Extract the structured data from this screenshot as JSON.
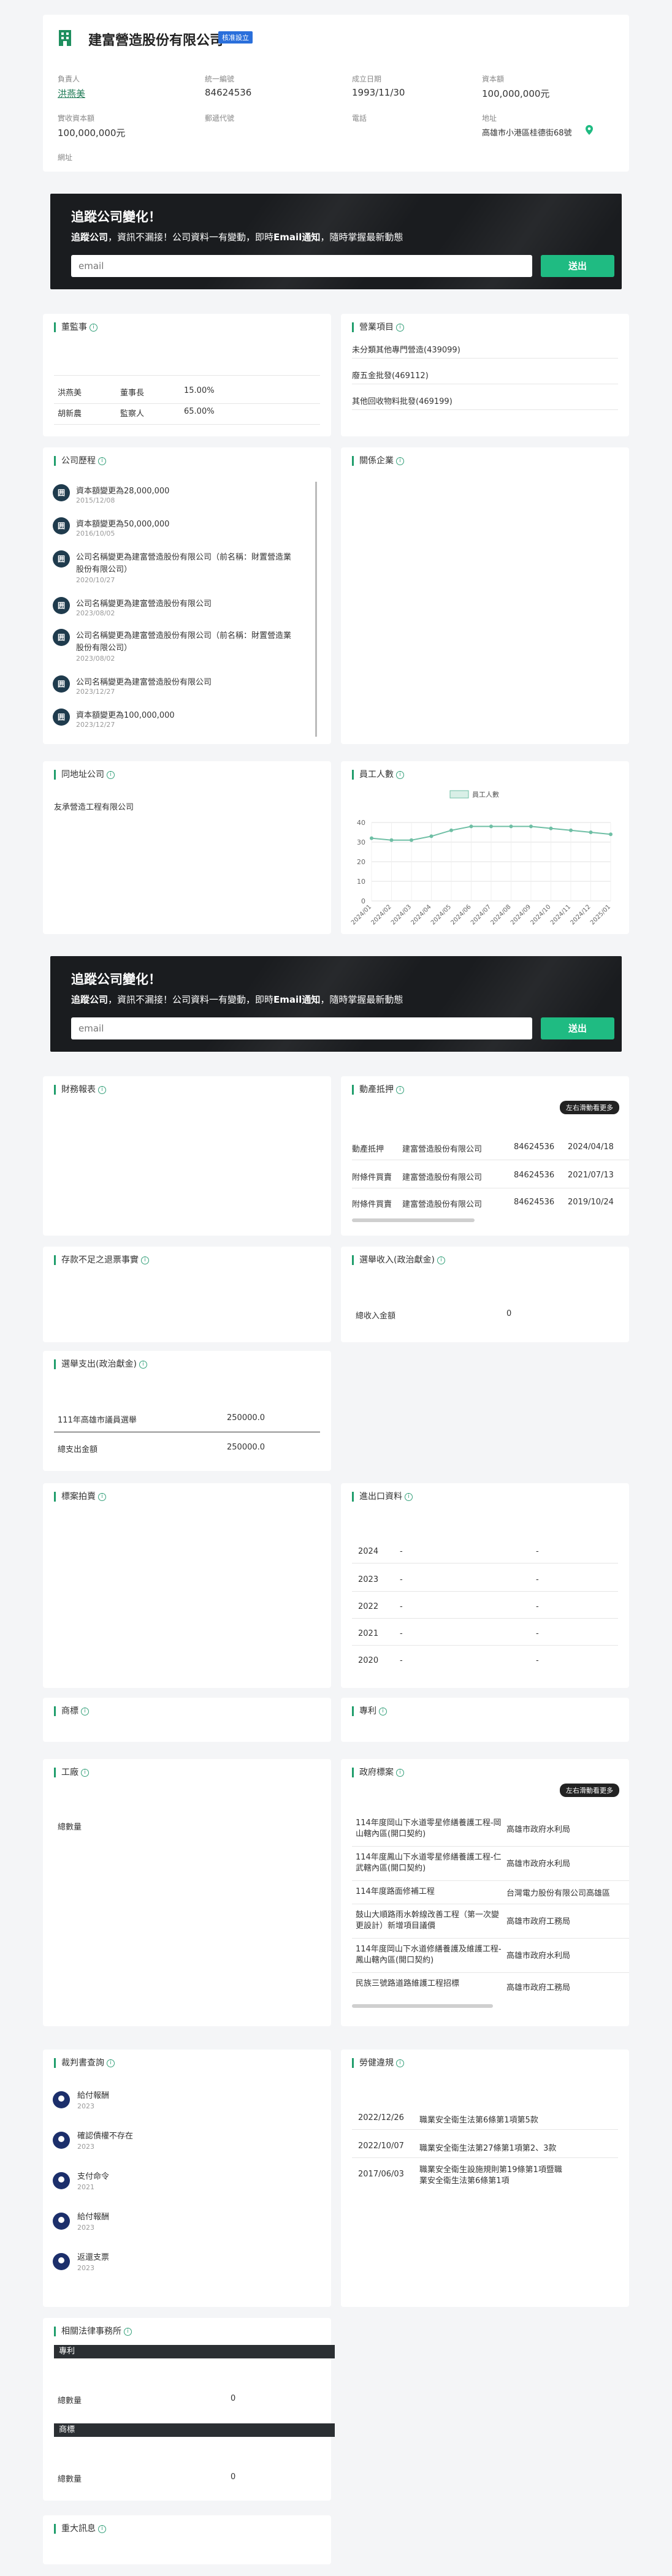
{
  "company": {
    "name": "建富營造股份有限公司",
    "status_badge": "核准設立",
    "fields": [
      {
        "label": "負責人",
        "value": "洪燕美"
      },
      {
        "label": "統一編號",
        "value": "84624536"
      },
      {
        "label": "成立日期",
        "value": "1993/11/30"
      },
      {
        "label": "資本額",
        "value": "100,000,000元"
      },
      {
        "label": "實收資本額",
        "value": "100,000,000元"
      },
      {
        "label": "郵遞代號",
        "value": ""
      },
      {
        "label": "電話",
        "value": ""
      },
      {
        "label": "地址",
        "value": "高雄市小港區桂德街68號"
      },
      {
        "label": "網址",
        "value": ""
      }
    ]
  },
  "banner": {
    "title": "追蹤公司變化！",
    "text_bold": "追蹤公司",
    "text_rest": "，資訊不漏接！公司資料一有變動，即時",
    "text_bold2": "Email通知",
    "text_end": "，隨時掌握最新動態",
    "placeholder": "email",
    "button": "送出"
  },
  "directors": {
    "title": "董監事",
    "rows": [
      {
        "name": "洪燕美",
        "role": "董事長",
        "pct": "15.00%"
      },
      {
        "name": "胡新農",
        "role": "監察人",
        "pct": "65.00%"
      }
    ]
  },
  "business": {
    "title": "營業項目",
    "items": [
      "未分類其他專門營造(439099)",
      "廢五金批發(469112)",
      "其他回收物料批發(469199)"
    ]
  },
  "history": {
    "title": "公司歷程",
    "items": [
      {
        "text": "資本額變更為28,000,000",
        "date": "2015/12/08"
      },
      {
        "text": "資本額變更為50,000,000",
        "date": "2016/10/05"
      },
      {
        "text": "公司名稱變更為建富營造股份有限公司（前名稱：財置營造業股份有限公司）",
        "date": "2020/10/27"
      },
      {
        "text": "公司名稱變更為建富營造股份有限公司",
        "date": "2023/08/02"
      },
      {
        "text": "公司名稱變更為建富營造股份有限公司（前名稱：財置營造業股份有限公司）",
        "date": "2023/08/02"
      },
      {
        "text": "公司名稱變更為建富營造股份有限公司",
        "date": "2023/12/27"
      },
      {
        "text": "資本額變更為100,000,000",
        "date": "2023/12/27"
      }
    ]
  },
  "related": {
    "title": "關係企業"
  },
  "same_address": {
    "title": "同地址公司",
    "items": [
      "友承營造工程有限公司"
    ]
  },
  "employees": {
    "title": "員工人數"
  },
  "chart_data": {
    "type": "line",
    "title": "",
    "legend": [
      "員工人數"
    ],
    "legend_position": "top",
    "x": [
      "2024/01",
      "2024/02",
      "2024/03",
      "2024/04",
      "2024/05",
      "2024/06",
      "2024/07",
      "2024/08",
      "2024/09",
      "2024/10",
      "2024/11",
      "2024/12",
      "2025/01"
    ],
    "series": [
      {
        "name": "員工人數",
        "values": [
          32,
          31,
          31,
          33,
          36,
          38,
          38,
          38,
          38,
          37,
          36,
          35,
          34
        ]
      }
    ],
    "ylim": [
      0,
      40
    ],
    "yticks": [
      0,
      10,
      20,
      30,
      40
    ],
    "grid": true,
    "color": "#6fbfa5"
  },
  "financial": {
    "title": "財務報表"
  },
  "movables": {
    "title": "動產抵押",
    "hint": "左右滑動看更多",
    "rows": [
      {
        "type": "動產抵押",
        "company": "建富營造股份有限公司",
        "tax": "84624536",
        "date": "2024/04/18"
      },
      {
        "type": "附條件買賣",
        "company": "建富營造股份有限公司",
        "tax": "84624536",
        "date": "2021/07/13"
      },
      {
        "type": "附條件買賣",
        "company": "建富營造股份有限公司",
        "tax": "84624536",
        "date": "2019/10/24"
      }
    ]
  },
  "deposit": {
    "title": "存款不足之退票事實"
  },
  "political_income": {
    "title": "選舉收入(政治獻金)",
    "total_label": "總收入金額",
    "total_value": "0"
  },
  "political_expense": {
    "title": "選舉支出(政治獻金)",
    "rows": [
      {
        "name": "111年高雄市議員選舉",
        "amount": "250000.0"
      }
    ],
    "total_label": "總支出金額",
    "total_value": "250000.0"
  },
  "tender": {
    "title": "標案拍賣"
  },
  "import_export": {
    "title": "進出口資料",
    "rows": [
      {
        "year": "2024",
        "a": "-",
        "b": "-"
      },
      {
        "year": "2023",
        "a": "-",
        "b": "-"
      },
      {
        "year": "2022",
        "a": "-",
        "b": "-"
      },
      {
        "year": "2021",
        "a": "-",
        "b": "-"
      },
      {
        "year": "2020",
        "a": "-",
        "b": "-"
      }
    ]
  },
  "trademark": {
    "title": "商標"
  },
  "patent": {
    "title": "專利"
  },
  "factory": {
    "title": "工廠",
    "total_label": "總數量"
  },
  "gov_tender": {
    "title": "政府標案",
    "hint": "左右滑動看更多",
    "rows": [
      {
        "name": "114年度岡山下水道零星修繕養護工程-岡山轄內區(開口契約)",
        "agency": "高雄市政府水利局"
      },
      {
        "name": "114年度鳳山下水道零星修繕養護工程-仁武轄內區(開口契約)",
        "agency": "高雄市政府水利局"
      },
      {
        "name": "114年度路面修補工程",
        "agency": "台灣電力股份有限公司高雄區"
      },
      {
        "name": "鼓山大順路雨水幹線改善工程（第一次變更設計）新增項目議價",
        "agency": "高雄市政府工務局"
      },
      {
        "name": "114年度岡山下水道修繕養護及維護工程-鳳山轄內區(開口契約)",
        "agency": "高雄市政府水利局"
      },
      {
        "name": "民族三號路道路維護工程招標",
        "agency": "高雄市政府工務局"
      }
    ]
  },
  "judgments": {
    "title": "裁判書查詢",
    "items": [
      {
        "name": "給付報酬",
        "year": "2023"
      },
      {
        "name": "確認債權不存在",
        "year": "2023"
      },
      {
        "name": "支付命令",
        "year": "2021"
      },
      {
        "name": "給付報酬",
        "year": "2023"
      },
      {
        "name": "返還支票",
        "year": "2023"
      }
    ]
  },
  "labor": {
    "title": "勞健違規",
    "rows": [
      {
        "date": "2022/12/26",
        "desc": "職業安全衛生法第6條第1項第5款"
      },
      {
        "date": "2022/10/07",
        "desc": "職業安全衛生法第27條第1項第2、3款"
      },
      {
        "date": "2017/06/03",
        "desc": "職業安全衛生設施規則第19條第1項暨職業安全衛生法第6條第1項"
      }
    ]
  },
  "law_firm": {
    "title": "相關法律事務所",
    "patent_head": "專利",
    "patent_total_label": "總數量",
    "patent_total_value": "0",
    "trademark_head": "商標",
    "trademark_total_label": "總數量",
    "trademark_total_value": "0"
  },
  "major": {
    "title": "重大訊息"
  }
}
